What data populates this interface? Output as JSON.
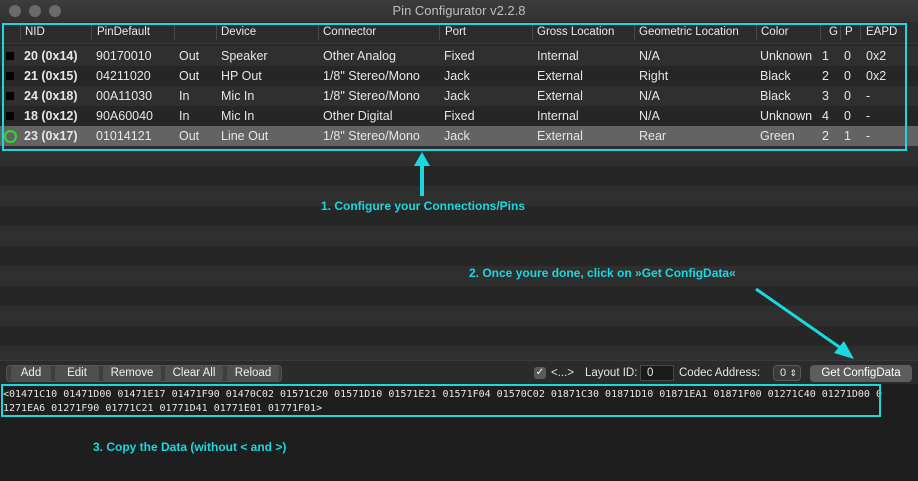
{
  "window": {
    "title": "Pin Configurator v2.2.8"
  },
  "table": {
    "columns": [
      "NID",
      "PinDefault",
      "",
      "Device",
      "Connector",
      "Port",
      "Gross Location",
      "Geometric Location",
      "Color",
      "G",
      "P",
      "EAPD"
    ],
    "rows": [
      {
        "nid": "20 (0x14)",
        "pindefault": "90170010",
        "dir": "Out",
        "device": "Speaker",
        "connector": "Other Analog",
        "port": "Fixed",
        "gross": "Internal",
        "geo": "N/A",
        "color": "Unknown",
        "g": "1",
        "p": "0",
        "eapd": "0x2"
      },
      {
        "nid": "21 (0x15)",
        "pindefault": "04211020",
        "dir": "Out",
        "device": "HP Out",
        "connector": "1/8\" Stereo/Mono",
        "port": "Jack",
        "gross": "External",
        "geo": "Right",
        "color": "Black",
        "g": "2",
        "p": "0",
        "eapd": "0x2"
      },
      {
        "nid": "24 (0x18)",
        "pindefault": "00A11030",
        "dir": "In",
        "device": "Mic In",
        "connector": "1/8\" Stereo/Mono",
        "port": "Jack",
        "gross": "External",
        "geo": "N/A",
        "color": "Black",
        "g": "3",
        "p": "0",
        "eapd": "-"
      },
      {
        "nid": "18 (0x12)",
        "pindefault": "90A60040",
        "dir": "In",
        "device": "Mic In",
        "connector": "Other Digital",
        "port": "Fixed",
        "gross": "Internal",
        "geo": "N/A",
        "color": "Unknown",
        "g": "4",
        "p": "0",
        "eapd": "-"
      },
      {
        "nid": "23 (0x17)",
        "pindefault": "01014121",
        "dir": "Out",
        "device": "Line Out",
        "connector": "1/8\" Stereo/Mono",
        "port": "Jack",
        "gross": "External",
        "geo": "Rear",
        "color": "Green",
        "g": "2",
        "p": "1",
        "eapd": "-"
      }
    ]
  },
  "annotations": {
    "step1": "1. Configure your Connections/Pins",
    "step2": "2. Once youre done, click on »Get ConfigData«",
    "step3": "3. Copy the Data (without < and >)"
  },
  "toolbar": {
    "add": "Add",
    "edit": "Edit",
    "remove": "Remove",
    "clear_all": "Clear All",
    "reload": "Reload",
    "checkbox_label": "<...>",
    "checkbox_checked": true,
    "layout_label": "Layout ID:",
    "layout_value": "0",
    "codec_label": "Codec Address:",
    "codec_value": "0",
    "get_config": "Get ConfigData"
  },
  "config_data": "<01471C10 01471D00 01471E17 01471F90 01470C02 01571C20 01571D10 01571E21 01571F04 01570C02 01871C30 01871D10 01871EA1 01871F00 01271C40 01271D00 01271EA6 01271F90 01771C21 01771D41 01771E01 01771F01>",
  "colors": {
    "accent": "#1ad8e0",
    "selected_row": "#636363",
    "pin_active": "#2fd92f"
  }
}
